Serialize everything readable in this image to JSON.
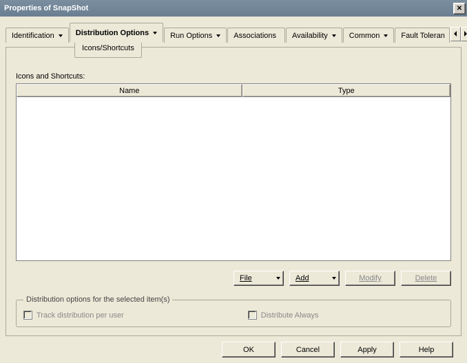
{
  "window": {
    "title": "Properties of SnapShot"
  },
  "tabs": {
    "identification": "Identification",
    "distribution_options": "Distribution Options",
    "run_options": "Run Options",
    "associations": "Associations",
    "availability": "Availability",
    "common": "Common",
    "fault_tolerance": "Fault Toleran",
    "subtab": "Icons/Shortcuts"
  },
  "panel": {
    "label": "Icons and Shortcuts:",
    "columns": {
      "name": "Name",
      "type": "Type"
    }
  },
  "buttons": {
    "file": "File",
    "add": "Add",
    "modify": "Modify",
    "delete": "Delete"
  },
  "groupbox": {
    "legend": "Distribution options for the selected item(s)",
    "track": "Track distribution per user",
    "always": "Distribute Always"
  },
  "dialog": {
    "ok": "OK",
    "cancel": "Cancel",
    "apply": "Apply",
    "help": "Help"
  }
}
